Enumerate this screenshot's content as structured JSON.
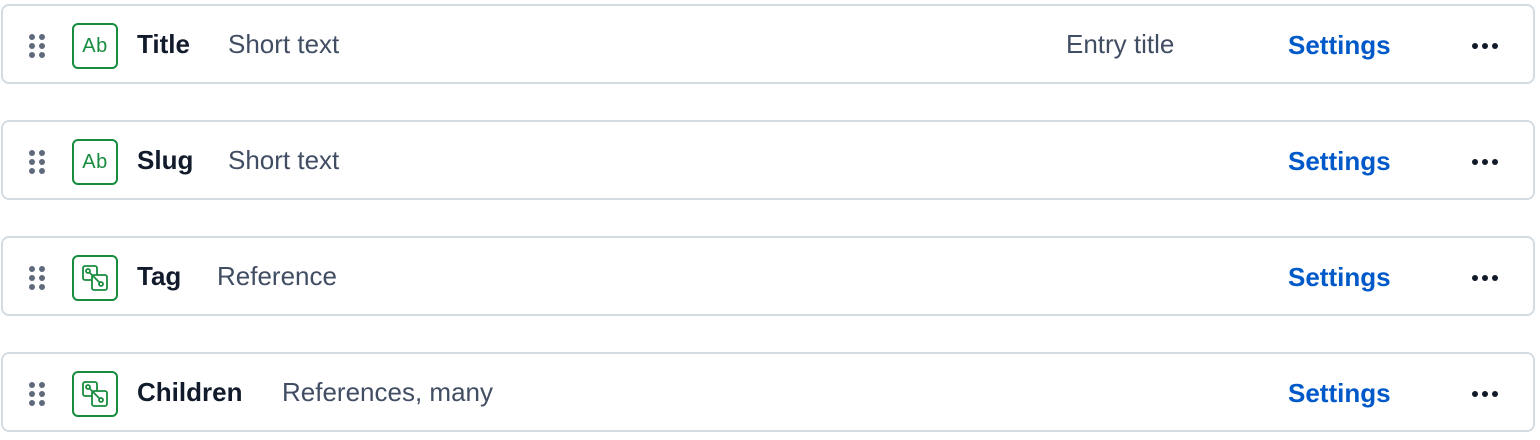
{
  "fields": [
    {
      "name": "Title",
      "type": "Short text",
      "icon": "short-text-icon",
      "icon_text": "Ab",
      "entry_title_label": "Entry title",
      "settings_label": "Settings"
    },
    {
      "name": "Slug",
      "type": "Short text",
      "icon": "short-text-icon",
      "icon_text": "Ab",
      "settings_label": "Settings"
    },
    {
      "name": "Tag",
      "type": "Reference",
      "icon": "reference-icon",
      "settings_label": "Settings"
    },
    {
      "name": "Children",
      "type": "References, many",
      "icon": "reference-icon",
      "settings_label": "Settings"
    }
  ],
  "colors": {
    "accent_green": "#178c3e",
    "link_blue": "#0059c8",
    "text_primary": "#111b2b",
    "text_secondary": "#414d63",
    "border": "#d3dce0"
  },
  "icons": {
    "drag": "drag-handle-icon",
    "more": "more-options-icon"
  }
}
